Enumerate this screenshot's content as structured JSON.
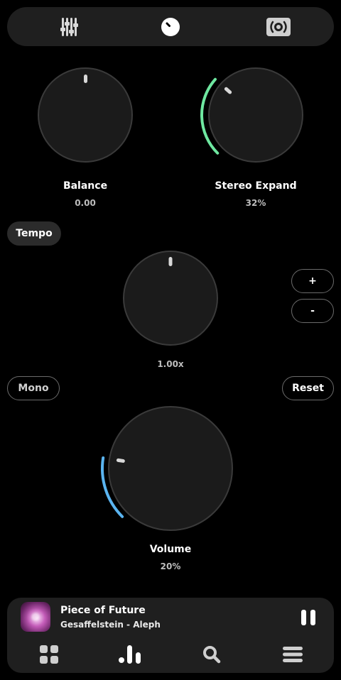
{
  "top_tabs": [
    {
      "name": "equalizer",
      "icon": "sliders-icon"
    },
    {
      "name": "knob",
      "icon": "knob-icon"
    },
    {
      "name": "surround",
      "icon": "surround-icon"
    }
  ],
  "balance": {
    "title": "Balance",
    "value": "0.00"
  },
  "stereo_expand": {
    "title": "Stereo Expand",
    "value": "32%",
    "level": 0.32,
    "arc_color": "#6ee7a0"
  },
  "tempo": {
    "label": "Tempo",
    "value": "1.00x",
    "plus_label": "+",
    "minus_label": "-"
  },
  "mono": {
    "label": "Mono"
  },
  "reset": {
    "label": "Reset"
  },
  "volume": {
    "title": "Volume",
    "value": "20%",
    "level": 0.2,
    "arc_color": "#5ab4f0"
  },
  "now_playing": {
    "title": "Piece of Future",
    "artist": "Gesaffelstein - Aleph"
  },
  "bottom_nav": [
    {
      "icon": "grid-icon"
    },
    {
      "icon": "bars-icon"
    },
    {
      "icon": "search-icon"
    },
    {
      "icon": "menu-icon"
    }
  ]
}
